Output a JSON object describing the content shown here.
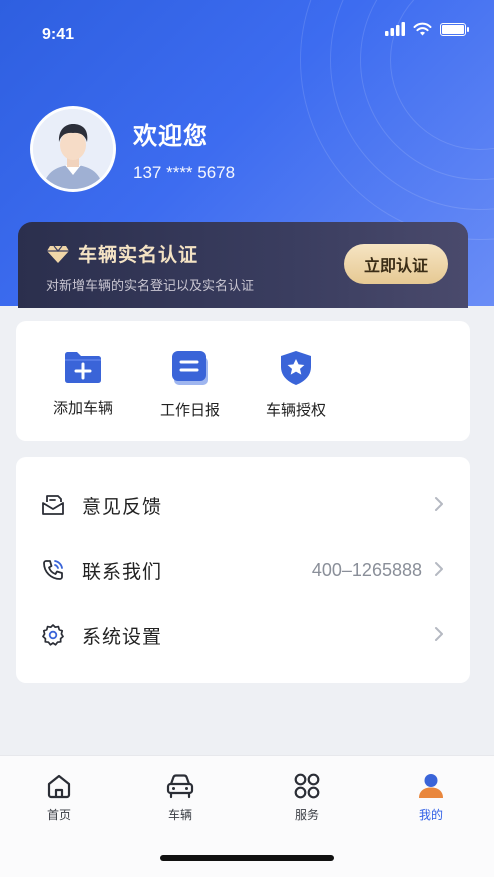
{
  "status_bar": {
    "time": "9:41"
  },
  "profile": {
    "welcome": "欢迎您",
    "phone": "137 **** 5678",
    "avatar_icon": "user-avatar"
  },
  "verify_banner": {
    "title": "车辆实名认证",
    "subtitle": "对新增车辆的实名登记以及实名认证",
    "button_label": "立即认证",
    "icon": "diamond-icon"
  },
  "quick_actions": [
    {
      "label": "添加车辆",
      "icon": "folder-plus-icon"
    },
    {
      "label": "工作日报",
      "icon": "report-icon"
    },
    {
      "label": "车辆授权",
      "icon": "shield-star-icon"
    }
  ],
  "menu": [
    {
      "label": "意见反馈",
      "value": "",
      "icon": "feedback-icon"
    },
    {
      "label": "联系我们",
      "value": "400–1265888",
      "icon": "phone-icon"
    },
    {
      "label": "系统设置",
      "value": "",
      "icon": "gear-icon"
    }
  ],
  "tabbar": [
    {
      "label": "首页",
      "icon": "home-icon",
      "active": false
    },
    {
      "label": "车辆",
      "icon": "car-icon",
      "active": false
    },
    {
      "label": "服务",
      "icon": "grid-icon",
      "active": false
    },
    {
      "label": "我的",
      "icon": "user-icon",
      "active": true
    }
  ],
  "colors": {
    "primary": "#2f5fe6",
    "gold": "#e6c993",
    "banner_dark": "#2b2f4d"
  }
}
